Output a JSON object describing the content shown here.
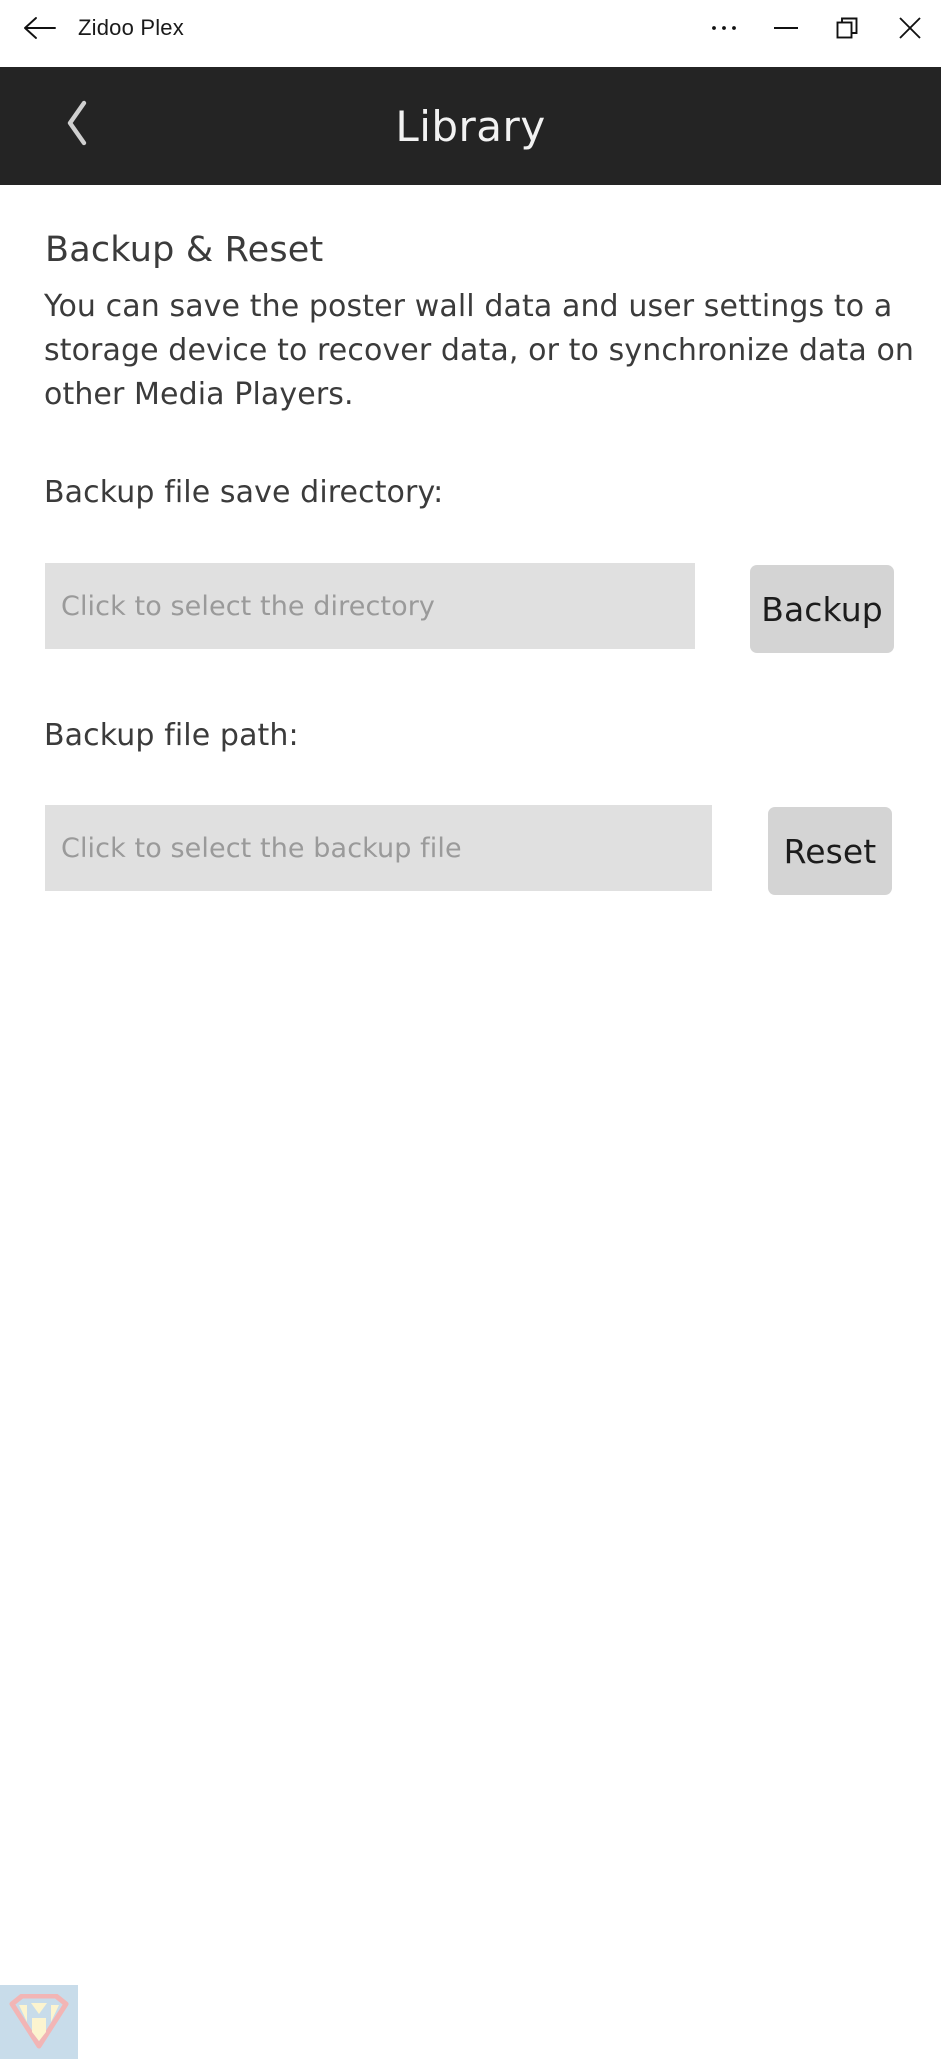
{
  "window": {
    "title": "Zidoo Plex",
    "back_icon": "arrow-left-icon",
    "controls": [
      {
        "name": "more-options-button",
        "icon": "ellipsis-icon",
        "label": "…"
      },
      {
        "name": "minimize-button",
        "icon": "minimize-icon",
        "label": "—"
      },
      {
        "name": "restore-button",
        "icon": "restore-icon",
        "label": "❐"
      },
      {
        "name": "close-button",
        "icon": "close-icon",
        "label": "✕"
      }
    ]
  },
  "appbar": {
    "title": "Library",
    "back_icon": "chevron-left-icon",
    "background_color": "#242424",
    "text_color": "#f2f2f2"
  },
  "main": {
    "section_title": "Backup & Reset",
    "section_description": "You can save the poster wall data and user settings to a storage device to recover data, or to synchronize data on other Media Players.",
    "directory": {
      "label": "Backup file save directory:",
      "input_value": "",
      "input_placeholder": "Click to select the directory",
      "button_label": "Backup"
    },
    "filepath": {
      "label": "Backup file path:",
      "input_value": "",
      "input_placeholder": "Click to select the backup file",
      "button_label": "Reset"
    }
  },
  "watermark": {
    "icon": "shield-m-logo-icon",
    "background_color": "#c8dcea",
    "outline_color": "#f0b8b8",
    "fill_color": "#fdf5d0"
  },
  "colors": {
    "page_background": "#ffffff",
    "input_background": "#e0e0e0",
    "button_background": "#d4d4d4",
    "text_primary": "#3b3b3b",
    "text_placeholder": "#9a9a9a"
  }
}
